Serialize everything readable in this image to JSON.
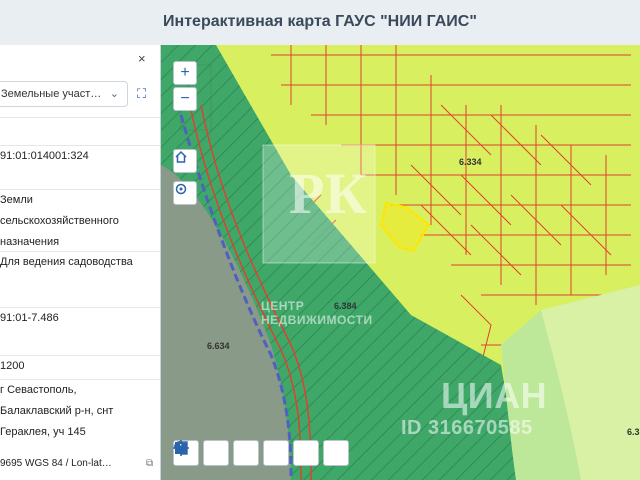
{
  "header": {
    "title": "Интерактивная карта ГАУС \"НИИ ГАИС\""
  },
  "panel": {
    "close_label": "×",
    "layer_select": {
      "value": "Земельные участ…",
      "icon": "chevron-down-icon"
    },
    "expand_icon": "expand-icon",
    "fields": [
      {
        "value": ""
      },
      {
        "value": "91:01:014001:324"
      },
      {
        "value": "Земли\nсельскохозяйственного\nназначения"
      },
      {
        "value": "Для ведения садоводства"
      },
      {
        "value": "91:01-7.486"
      },
      {
        "value": "1200"
      },
      {
        "value": "г Севастополь,\nБалаклавский р-н, снт\nГераклея, уч 145"
      }
    ],
    "coord_text": "9695 WGS 84 / Lon-lat…"
  },
  "map": {
    "zoom_in": "+",
    "zoom_out": "−",
    "labels": [
      "6.334",
      "6.384",
      "6.634",
      "6.3"
    ],
    "watermark_text": "ЦЕНТР\nНЕДВИЖИМОСТИ",
    "watermark_logo": "РК",
    "watermark_cian": "ЦИАН",
    "watermark_id": "ID 316670585",
    "colors": {
      "parcels_bg": "#d8f060",
      "zone_green": "#2fa06a",
      "zone_grey": "#8a9a88",
      "light_green": "#bde89a",
      "parcel_border": "#e04030",
      "selected_parcel": "#ffe600",
      "road": "#5060c0"
    },
    "tools": [
      {
        "name": "zoom-in-tool-icon"
      },
      {
        "name": "zoom-out-tool-icon"
      },
      {
        "name": "ruler-icon"
      },
      {
        "name": "area-measure-icon"
      },
      {
        "name": "compare-icon"
      },
      {
        "name": "locate-icon"
      }
    ]
  }
}
